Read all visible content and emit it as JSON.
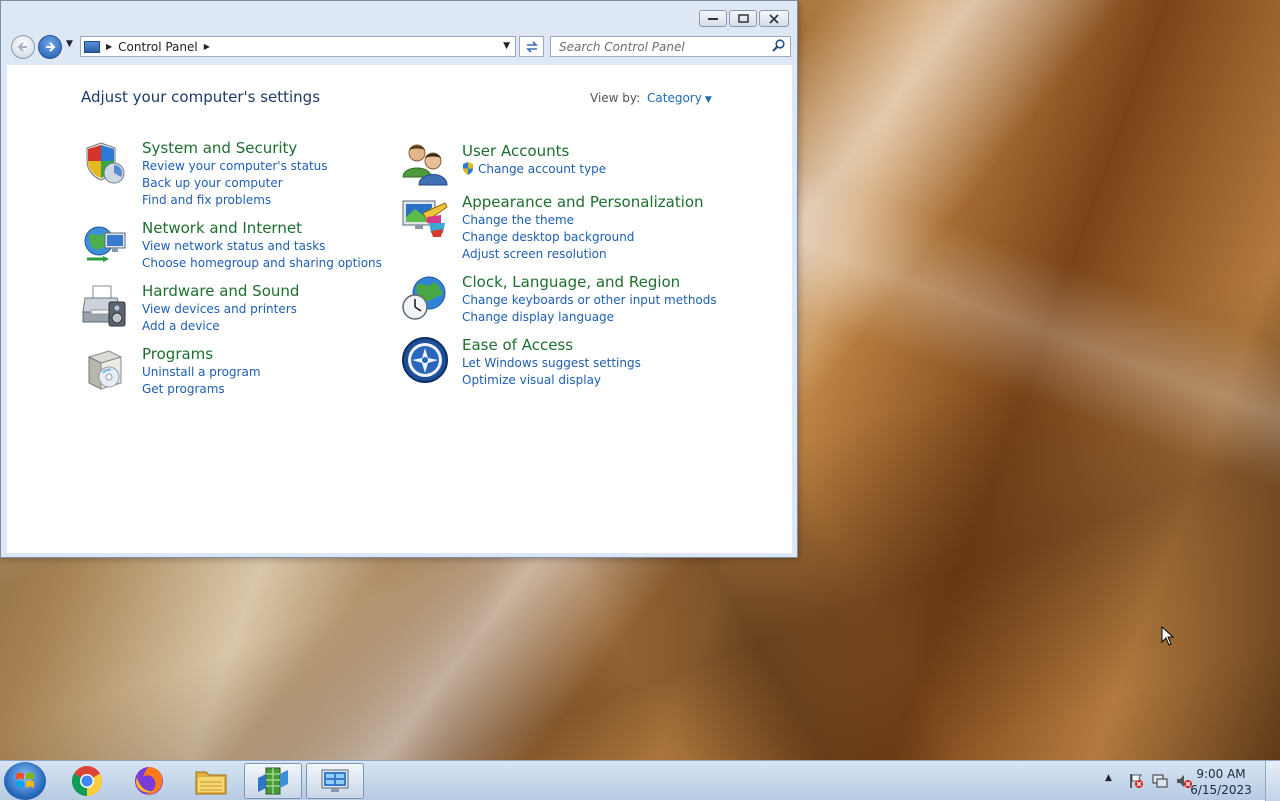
{
  "window": {
    "address": {
      "crumb": "Control Panel"
    },
    "search": {
      "placeholder": "Search Control Panel"
    }
  },
  "content": {
    "page_title": "Adjust your computer's settings",
    "view_by": {
      "label": "View by:",
      "value": "Category"
    }
  },
  "categories": {
    "system": {
      "title": "System and Security",
      "links": [
        "Review your computer's status",
        "Back up your computer",
        "Find and fix problems"
      ]
    },
    "network": {
      "title": "Network and Internet",
      "links": [
        "View network status and tasks",
        "Choose homegroup and sharing options"
      ]
    },
    "hardware": {
      "title": "Hardware and Sound",
      "links": [
        "View devices and printers",
        "Add a device"
      ]
    },
    "programs": {
      "title": "Programs",
      "links": [
        "Uninstall a program",
        "Get programs"
      ]
    },
    "users": {
      "title": "User Accounts",
      "links": [
        "Change account type"
      ]
    },
    "appearance": {
      "title": "Appearance and Personalization",
      "links": [
        "Change the theme",
        "Change desktop background",
        "Adjust screen resolution"
      ]
    },
    "clock": {
      "title": "Clock, Language, and Region",
      "links": [
        "Change keyboards or other input methods",
        "Change display language"
      ]
    },
    "ease": {
      "title": "Ease of Access",
      "links": [
        "Let Windows suggest settings",
        "Optimize visual display"
      ]
    }
  },
  "taskbar": {
    "items": [
      "start-orb",
      "chrome-icon",
      "firefox-icon",
      "file-explorer-icon",
      "python-app-icon",
      "control-panel-icon"
    ],
    "clock": {
      "time": "9:00 AM",
      "date": "6/15/2023"
    }
  },
  "colors": {
    "link": "#1e5fb0",
    "category_title": "#1e6e2e",
    "page_title": "#1e3a6a"
  }
}
